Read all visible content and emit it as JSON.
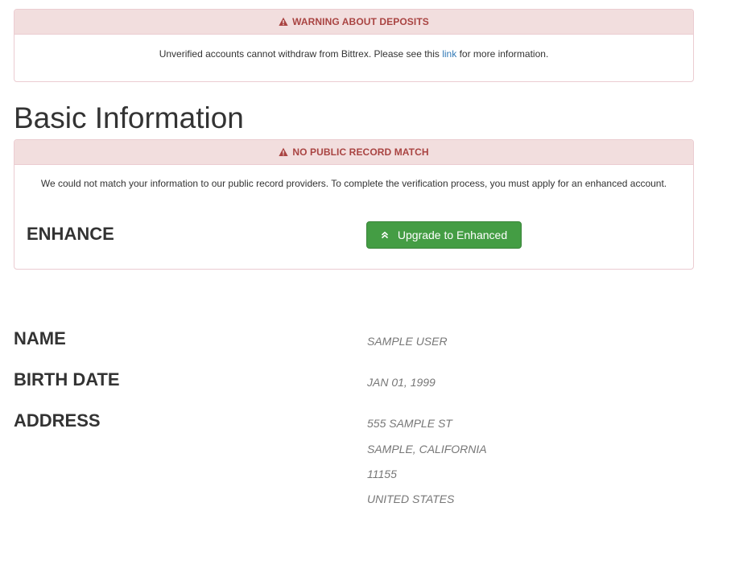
{
  "deposits_warning": {
    "heading": "WARNING ABOUT DEPOSITS",
    "icon": "warning-triangle-icon",
    "text_before": "Unverified accounts cannot withdraw from Bittrex. Please see this ",
    "link_label": "link",
    "text_after": " for more information."
  },
  "page_title": "Basic Information",
  "record_warning": {
    "heading": "NO PUBLIC RECORD MATCH",
    "icon": "warning-triangle-icon",
    "message": "We could not match your information to our public record providers. To complete the verification process, you must apply for an enhanced account.",
    "enhance_label": "ENHANCE",
    "upgrade_button": {
      "label": "Upgrade to Enhanced",
      "icon": "chevron-double-up-icon",
      "color": "#449d44"
    }
  },
  "profile": {
    "name_label": "NAME",
    "name_value": "SAMPLE USER",
    "birth_label": "BIRTH DATE",
    "birth_value": "JAN 01, 1999",
    "address_label": "ADDRESS",
    "address_lines": [
      "555 SAMPLE ST",
      "SAMPLE, CALIFORNIA",
      "11155",
      "UNITED STATES"
    ]
  },
  "colors": {
    "danger_bg": "#f2dede",
    "danger_text": "#a94442",
    "danger_border": "#ebccd1",
    "link": "#337ab7",
    "success": "#449d44"
  }
}
